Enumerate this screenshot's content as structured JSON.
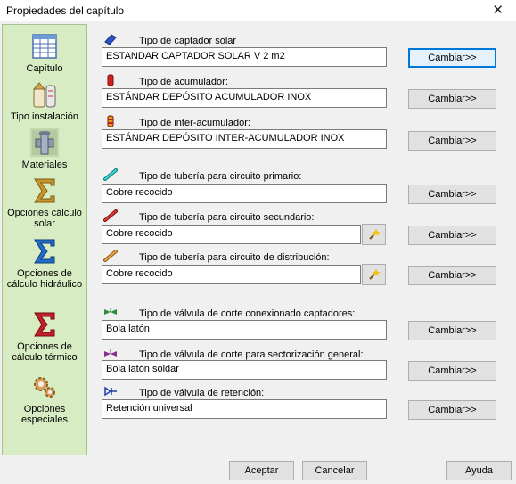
{
  "window": {
    "title": "Propiedades del capítulo",
    "close_glyph": "✕"
  },
  "sidebar": {
    "items": [
      {
        "label": "Capítulo",
        "icon": "chapter-table-icon"
      },
      {
        "label": "Tipo instalación",
        "icon": "installation-type-icon"
      },
      {
        "label": "Materiales",
        "icon": "pipe-fitting-icon",
        "selected": true
      },
      {
        "label": "Opciones cálculo solar",
        "icon": "sigma-gold-icon"
      },
      {
        "label": "Opciones de cálculo hidráulico",
        "icon": "sigma-blue-icon"
      },
      {
        "label": "Opciones de cálculo térmico",
        "icon": "sigma-red-icon"
      },
      {
        "label": "Opciones especiales",
        "icon": "gears-icon"
      }
    ]
  },
  "sections": [
    {
      "label": "Tipo de captador solar",
      "value": "ESTANDAR CAPTADOR SOLAR V 2 m2",
      "button": "Cambiar>>",
      "icon": "solar-collector-icon"
    },
    {
      "label": "Tipo de acumulador:",
      "value": "ESTÁNDAR DEPÓSITO ACUMULADOR INOX",
      "button": "Cambiar>>",
      "icon": "red-tank-icon"
    },
    {
      "label": "Tipo de inter-acumulador:",
      "value": "ESTÁNDAR DEPÓSITO INTER-ACUMULADOR INOX",
      "button": "Cambiar>>",
      "icon": "striped-tank-icon"
    },
    {
      "label": "Tipo de tubería para circuito primario:",
      "value": "Cobre recocido",
      "button": "Cambiar>>",
      "icon": "cyan-pipe-icon"
    },
    {
      "label": "Tipo de tubería para circuito secundario:",
      "value": "Cobre recocido",
      "button": "Cambiar>>",
      "icon": "red-pipe-icon"
    },
    {
      "label": "Tipo de tubería para circuito de distribución:",
      "value": "Cobre recocido",
      "button": "Cambiar>>",
      "icon": "orange-pipe-icon"
    },
    {
      "label": "Tipo de válvula de corte conexionado captadores:",
      "value": "Bola latón",
      "button": "Cambiar>>",
      "icon": "green-valve-icon"
    },
    {
      "label": "Tipo de válvula de corte para sectorización general:",
      "value": "Bola latón soldar",
      "button": "Cambiar>>",
      "icon": "purple-valve-icon"
    },
    {
      "label": "Tipo de válvula de retención:",
      "value": "Retención universal",
      "button": "Cambiar>>",
      "icon": "check-valve-icon"
    }
  ],
  "footer": {
    "accept": "Aceptar",
    "cancel": "Cancelar",
    "help": "Ayuda"
  }
}
